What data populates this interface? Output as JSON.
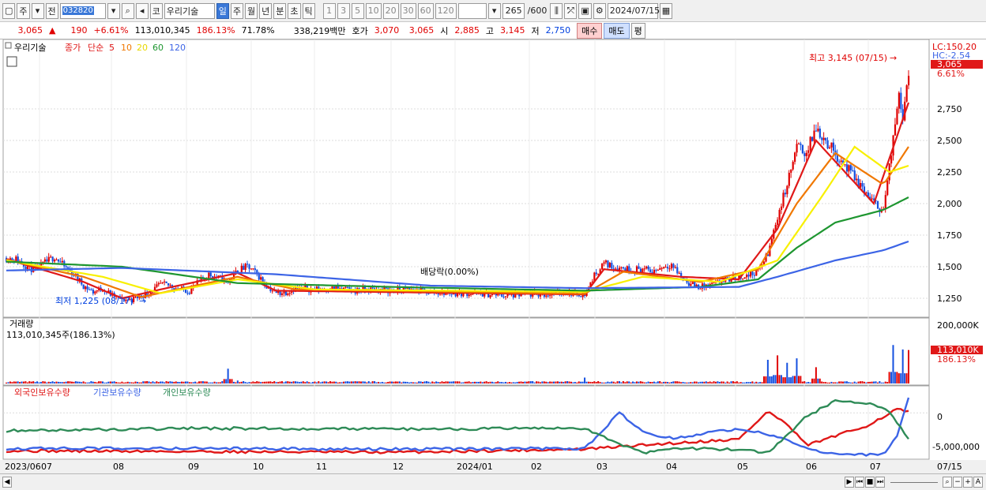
{
  "toolbar": {
    "market": "주",
    "prev": "전",
    "code": "032820",
    "kr_label": "코",
    "stock_name": "우리기술",
    "periods": [
      "일",
      "주",
      "월",
      "년",
      "분",
      "초",
      "틱"
    ],
    "selected_period": "일",
    "intervals": [
      "1",
      "3",
      "5",
      "10",
      "20",
      "30",
      "60",
      "120"
    ],
    "count": "265",
    "count_total": "/600",
    "date": "2024/07/15"
  },
  "info": {
    "price": "3,065",
    "change_arrow": "▲",
    "change": "190",
    "change_pct": "+6.61%",
    "volume": "113,010,345",
    "volume_pct": "186.13%",
    "turnover_pct": "71.78%",
    "amount": "338,219백만",
    "quote_label": "호가",
    "ask": "3,070",
    "bid": "3,065",
    "open_label": "시",
    "open": "2,885",
    "high_label": "고",
    "high": "3,145",
    "low_label": "저",
    "low": "2,750",
    "buy_label": "매수",
    "sell_label": "매도",
    "eval_label": "평"
  },
  "colors": {
    "up": "#e00000",
    "down": "#1550e0",
    "ma5": "#e01818",
    "ma10": "#f07800",
    "ma20": "#f8f000",
    "ma60": "#1e9630",
    "ma120": "#3c64e6",
    "foreign": "#e01818",
    "inst": "#3c64e6",
    "indiv": "#2e8b57"
  },
  "legend": {
    "stock": "우리기술",
    "close_label": "종가",
    "simple_label": "단순",
    "ma": [
      "5",
      "10",
      "20",
      "60",
      "120"
    ]
  },
  "annotations": {
    "high": "최고 3,145 (07/15)",
    "low": "최저 1,225 (08/17)",
    "dividend": "배당락(0.00%)"
  },
  "right_labels": {
    "lc": "LC:150.20",
    "hc": "HC:-2.54",
    "price_tag": "3,065",
    "pct_tag": "6.61%"
  },
  "volume_panel": {
    "title": "거래량",
    "value": "113,010,345주(186.13%)",
    "axis_max": "200,000K",
    "tag_value": "113,010K",
    "tag_pct": "186.13%"
  },
  "holdings_panel": {
    "labels": [
      "외국인보유수량",
      "기관보유수량",
      "개인보유수량"
    ],
    "axis_top": "0",
    "axis_bottom": "-5,000,000"
  },
  "x_axis": [
    "2023/06",
    "07",
    "08",
    "09",
    "10",
    "11",
    "12",
    "2024/01",
    "02",
    "03",
    "04",
    "05",
    "06",
    "07",
    "07/15"
  ],
  "chart_data": {
    "type": "line",
    "title": "우리기술",
    "y_price_ticks": [
      1250,
      1500,
      1750,
      2000,
      2250,
      2500,
      2750
    ],
    "price_range": [
      1100,
      3300
    ],
    "price_path": [
      [
        0,
        1570
      ],
      [
        5,
        1560
      ],
      [
        10,
        1510
      ],
      [
        15,
        1470
      ],
      [
        20,
        1530
      ],
      [
        25,
        1580
      ],
      [
        30,
        1500
      ],
      [
        35,
        1440
      ],
      [
        40,
        1350
      ],
      [
        45,
        1300
      ],
      [
        50,
        1330
      ],
      [
        55,
        1270
      ],
      [
        60,
        1240
      ],
      [
        65,
        1240
      ],
      [
        70,
        1270
      ],
      [
        75,
        1300
      ],
      [
        80,
        1360
      ],
      [
        85,
        1350
      ],
      [
        90,
        1320
      ],
      [
        95,
        1310
      ],
      [
        100,
        1380
      ],
      [
        105,
        1440
      ],
      [
        110,
        1410
      ],
      [
        115,
        1380
      ],
      [
        120,
        1470
      ],
      [
        125,
        1500
      ],
      [
        130,
        1440
      ],
      [
        135,
        1350
      ],
      [
        140,
        1290
      ],
      [
        145,
        1300
      ],
      [
        150,
        1330
      ],
      [
        160,
        1320
      ],
      [
        170,
        1330
      ],
      [
        180,
        1310
      ],
      [
        190,
        1320
      ],
      [
        200,
        1310
      ],
      [
        210,
        1320
      ],
      [
        220,
        1300
      ],
      [
        230,
        1290
      ],
      [
        240,
        1290
      ],
      [
        250,
        1280
      ],
      [
        260,
        1270
      ],
      [
        270,
        1280
      ],
      [
        280,
        1280
      ],
      [
        290,
        1300
      ],
      [
        300,
        1280
      ],
      [
        305,
        1430
      ],
      [
        310,
        1530
      ],
      [
        315,
        1500
      ],
      [
        320,
        1490
      ],
      [
        325,
        1480
      ],
      [
        330,
        1480
      ],
      [
        335,
        1460
      ],
      [
        340,
        1500
      ],
      [
        345,
        1520
      ],
      [
        350,
        1420
      ],
      [
        355,
        1360
      ],
      [
        360,
        1340
      ],
      [
        365,
        1350
      ],
      [
        370,
        1380
      ],
      [
        375,
        1400
      ],
      [
        380,
        1420
      ],
      [
        385,
        1430
      ],
      [
        390,
        1470
      ],
      [
        395,
        1600
      ],
      [
        400,
        1900
      ],
      [
        405,
        2150
      ],
      [
        410,
        2450
      ],
      [
        415,
        2400
      ],
      [
        420,
        2600
      ],
      [
        425,
        2500
      ],
      [
        430,
        2400
      ],
      [
        435,
        2300
      ],
      [
        440,
        2200
      ],
      [
        445,
        2100
      ],
      [
        450,
        2000
      ],
      [
        455,
        1950
      ],
      [
        460,
        2500
      ],
      [
        463,
        2900
      ],
      [
        465,
        2700
      ],
      [
        468,
        3065
      ]
    ],
    "ma_series": [
      {
        "name": "5",
        "anchors": [
          [
            0,
            1560
          ],
          [
            40,
            1380
          ],
          [
            60,
            1250
          ],
          [
            80,
            1320
          ],
          [
            120,
            1450
          ],
          [
            140,
            1310
          ],
          [
            300,
            1280
          ],
          [
            310,
            1480
          ],
          [
            350,
            1420
          ],
          [
            380,
            1400
          ],
          [
            400,
            1800
          ],
          [
            420,
            2500
          ],
          [
            450,
            2000
          ],
          [
            468,
            2800
          ]
        ]
      },
      {
        "name": "10",
        "anchors": [
          [
            0,
            1555
          ],
          [
            40,
            1420
          ],
          [
            70,
            1260
          ],
          [
            120,
            1420
          ],
          [
            150,
            1320
          ],
          [
            300,
            1285
          ],
          [
            320,
            1460
          ],
          [
            360,
            1380
          ],
          [
            390,
            1480
          ],
          [
            410,
            2000
          ],
          [
            430,
            2400
          ],
          [
            455,
            2150
          ],
          [
            468,
            2450
          ]
        ]
      },
      {
        "name": "20",
        "anchors": [
          [
            0,
            1550
          ],
          [
            50,
            1420
          ],
          [
            80,
            1290
          ],
          [
            120,
            1400
          ],
          [
            160,
            1320
          ],
          [
            300,
            1300
          ],
          [
            330,
            1420
          ],
          [
            370,
            1380
          ],
          [
            400,
            1550
          ],
          [
            425,
            2100
          ],
          [
            440,
            2450
          ],
          [
            458,
            2250
          ],
          [
            468,
            2300
          ]
        ]
      },
      {
        "name": "60",
        "anchors": [
          [
            0,
            1540
          ],
          [
            60,
            1500
          ],
          [
            120,
            1370
          ],
          [
            200,
            1340
          ],
          [
            300,
            1310
          ],
          [
            360,
            1340
          ],
          [
            390,
            1400
          ],
          [
            410,
            1650
          ],
          [
            430,
            1850
          ],
          [
            455,
            1950
          ],
          [
            468,
            2050
          ]
        ]
      },
      {
        "name": "120",
        "anchors": [
          [
            0,
            1470
          ],
          [
            60,
            1490
          ],
          [
            140,
            1440
          ],
          [
            220,
            1350
          ],
          [
            300,
            1330
          ],
          [
            380,
            1340
          ],
          [
            400,
            1420
          ],
          [
            430,
            1550
          ],
          [
            455,
            1630
          ],
          [
            468,
            1700
          ]
        ]
      }
    ],
    "volume_spikes": [
      [
        115,
        50
      ],
      [
        120,
        10
      ],
      [
        300,
        20
      ],
      [
        395,
        80
      ],
      [
        400,
        95
      ],
      [
        405,
        70
      ],
      [
        410,
        85
      ],
      [
        420,
        55
      ],
      [
        460,
        130
      ],
      [
        465,
        115
      ],
      [
        468,
        113
      ]
    ],
    "holdings_series": [
      {
        "name": "외국인보유수량",
        "anchors": [
          [
            0,
            -4.9
          ],
          [
            100,
            -5.0
          ],
          [
            200,
            -5.1
          ],
          [
            300,
            -4.7
          ],
          [
            340,
            -4.0
          ],
          [
            380,
            -3.4
          ],
          [
            395,
            0.2
          ],
          [
            405,
            -1.5
          ],
          [
            415,
            -4.2
          ],
          [
            430,
            -3.0
          ],
          [
            445,
            -1.8
          ],
          [
            455,
            -0.5
          ],
          [
            462,
            0.5
          ],
          [
            468,
            0.1
          ]
        ]
      },
      {
        "name": "기관보유수량",
        "anchors": [
          [
            0,
            -4.6
          ],
          [
            100,
            -4.6
          ],
          [
            200,
            -4.7
          ],
          [
            300,
            -4.6
          ],
          [
            318,
            0.0
          ],
          [
            330,
            -2.5
          ],
          [
            345,
            -3.3
          ],
          [
            380,
            -2.0
          ],
          [
            400,
            -3.0
          ],
          [
            415,
            -4.5
          ],
          [
            430,
            -5.4
          ],
          [
            455,
            -5.4
          ],
          [
            462,
            -3.0
          ],
          [
            468,
            2.0
          ]
        ]
      },
      {
        "name": "개인보유수량",
        "anchors": [
          [
            0,
            -2.3
          ],
          [
            100,
            -2.0
          ],
          [
            200,
            -2.1
          ],
          [
            300,
            -2.0
          ],
          [
            318,
            -4.0
          ],
          [
            330,
            -5.2
          ],
          [
            345,
            -4.5
          ],
          [
            380,
            -4.8
          ],
          [
            395,
            -5.2
          ],
          [
            415,
            -0.5
          ],
          [
            430,
            1.6
          ],
          [
            450,
            1.2
          ],
          [
            458,
            0.2
          ],
          [
            468,
            -3.5
          ]
        ]
      }
    ],
    "holdings_range": [
      -6.0,
      3.5
    ]
  }
}
